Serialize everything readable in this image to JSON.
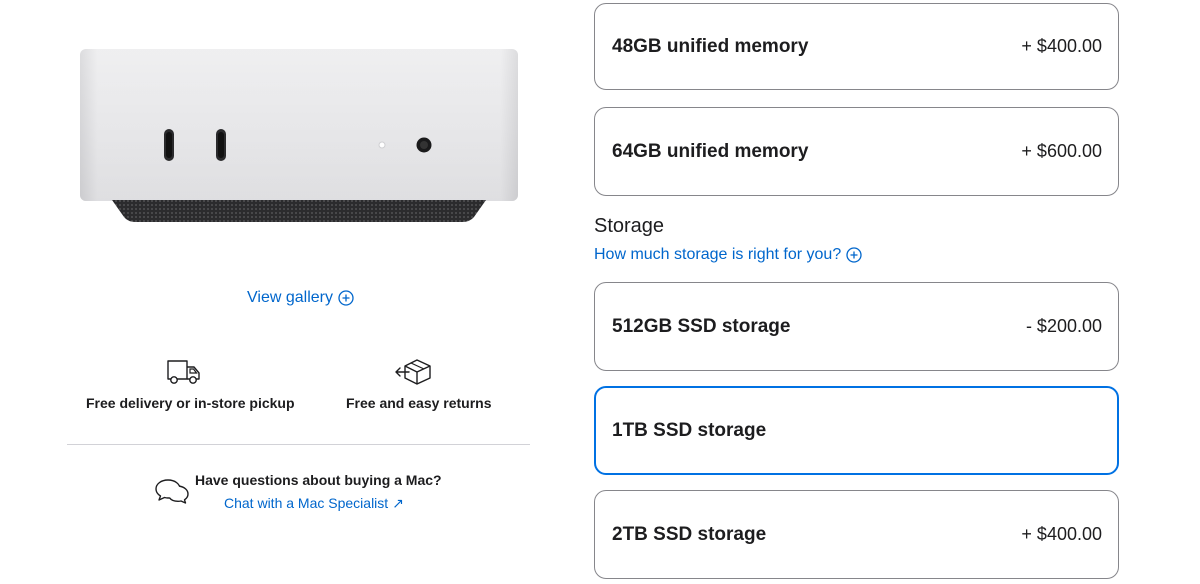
{
  "gallery": {
    "label": "View gallery"
  },
  "features": {
    "delivery": "Free delivery or in-store pickup",
    "returns": "Free and easy returns"
  },
  "chat": {
    "question": "Have questions about buying a Mac?",
    "link": "Chat with a Mac Specialist ↗"
  },
  "memory_options": [
    {
      "name": "48GB unified memory",
      "price": "+ $400.00"
    },
    {
      "name": "64GB unified memory",
      "price": "+ $600.00"
    }
  ],
  "storage": {
    "title": "Storage",
    "help": "How much storage is right for you?",
    "options": [
      {
        "name": "512GB SSD storage",
        "price": "- $200.00",
        "selected": false
      },
      {
        "name": "1TB SSD storage",
        "price": "",
        "selected": true
      },
      {
        "name": "2TB SSD storage",
        "price": "+ $400.00",
        "selected": false
      }
    ]
  },
  "colors": {
    "link": "#0066cc",
    "selected_border": "#0071e3",
    "border": "#86868b"
  }
}
